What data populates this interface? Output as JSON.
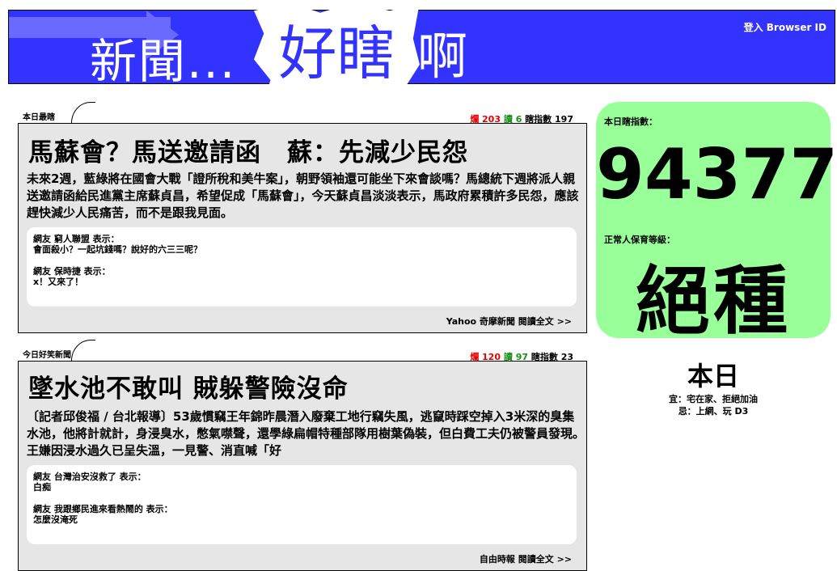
{
  "header": {
    "logo_part1": "新聞...",
    "logo_part2": "好瞎",
    "logo_part3": "啊",
    "login_label": "登入 Browser ID"
  },
  "news": [
    {
      "tab_label": "本日最瞎",
      "stats": {
        "lan_label": "爛",
        "lan_value": "203",
        "du_label": "讀",
        "du_value": "6",
        "index_label": "瞎指數",
        "index_value": "197"
      },
      "headline": "馬蘇會？馬送邀請函　蘇：先減少民怨",
      "summary": "未來2週，藍綠將在國會大戰「證所稅和美牛案」，朝野領袖還可能坐下來會談嗎？馬總統下週將派人親送邀請函給民進黨主席蘇貞昌，希望促成「馬蘇會」，今天蘇貞昌淡淡表示，馬政府累積許多民怨，應該趕快減少人民痛苦，而不是跟我見面。",
      "comments": [
        {
          "author": "網友 窮人聯盟 表示：",
          "text": "會面殺小？一起坑錢嗎？說好的六三三呢？"
        },
        {
          "author": "網友 保時捷 表示：",
          "text": "x！又來了！"
        }
      ],
      "source": "Yahoo 奇摩新聞",
      "read_more": "閱讀全文 >>"
    },
    {
      "tab_label": "今日好笑新聞",
      "stats": {
        "lan_label": "爛",
        "lan_value": "120",
        "du_label": "讀",
        "du_value": "97",
        "index_label": "瞎指數",
        "index_value": "23"
      },
      "headline": "墜水池不敢叫 賊躲警險沒命",
      "summary": "〔記者邱俊福 / 台北報導〕53歲慣竊王年錦昨晨潛入廢棄工地行竊失風，逃竄時踩空掉入3米深的臭集水池，他將計就計，身浸臭水，憋氣噤聲，還學綠扁帽特種部隊用樹葉偽裝，但白費工夫仍被警員發現。王嫌因浸水過久已呈失溫，一見警、消直喊「好",
      "comments": [
        {
          "author": "網友 台灣治安沒救了 表示：",
          "text": "白痴"
        },
        {
          "author": "網友 我跟鄉民進來看熱鬧的 表示：",
          "text": "怎麼沒淹死"
        }
      ],
      "source": "自由時報",
      "read_more": "閱讀全文 >>"
    }
  ],
  "index_box": {
    "label": "本日瞎指數：",
    "value": "94377",
    "grade_label": "正常人保育等級：",
    "grade_value": "絕種"
  },
  "today": {
    "title": "本日",
    "do_line": "宜：宅在家、拒絕加油",
    "dont_line": "忌：上網、玩 D3"
  },
  "colors": {
    "header_blue": "#3333ff",
    "index_green": "#99ff99",
    "panel_gray": "#e6e6e6",
    "stat_red": "#e60000",
    "stat_green": "#1a8f1a"
  }
}
